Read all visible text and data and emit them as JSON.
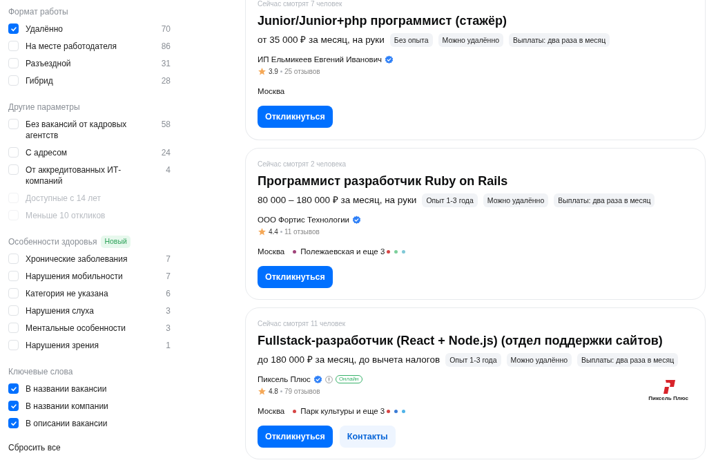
{
  "filters": [
    {
      "title": "Формат работы",
      "items": [
        {
          "label": "Удалённо",
          "count": "70",
          "checked": true,
          "disabled": false
        },
        {
          "label": "На месте работодателя",
          "count": "86",
          "checked": false,
          "disabled": false
        },
        {
          "label": "Разъездной",
          "count": "31",
          "checked": false,
          "disabled": false
        },
        {
          "label": "Гибрид",
          "count": "28",
          "checked": false,
          "disabled": false
        }
      ]
    },
    {
      "title": "Другие параметры",
      "items": [
        {
          "label": "Без вакансий от кадровых агентств",
          "count": "58",
          "checked": false,
          "disabled": false
        },
        {
          "label": "С адресом",
          "count": "24",
          "checked": false,
          "disabled": false
        },
        {
          "label": "От аккредитованных ИТ-компаний",
          "count": "4",
          "checked": false,
          "disabled": false
        },
        {
          "label": "Доступные с 14 лет",
          "checked": false,
          "disabled": true
        },
        {
          "label": "Меньше 10 откликов",
          "checked": false,
          "disabled": true
        }
      ]
    },
    {
      "title": "Особенности здоровья",
      "badge": "Новый",
      "items": [
        {
          "label": "Хронические заболевания",
          "count": "7",
          "checked": false,
          "disabled": false
        },
        {
          "label": "Нарушения мобильности",
          "count": "7",
          "checked": false,
          "disabled": false
        },
        {
          "label": "Категория не указана",
          "count": "6",
          "checked": false,
          "disabled": false
        },
        {
          "label": "Нарушения слуха",
          "count": "3",
          "checked": false,
          "disabled": false
        },
        {
          "label": "Ментальные особенности",
          "count": "3",
          "checked": false,
          "disabled": false
        },
        {
          "label": "Нарушения зрения",
          "count": "1",
          "checked": false,
          "disabled": false
        }
      ]
    },
    {
      "title": "Ключевые слова",
      "items": [
        {
          "label": "В названии вакансии",
          "checked": true,
          "disabled": false
        },
        {
          "label": "В названии компании",
          "checked": true,
          "disabled": false
        },
        {
          "label": "В описании вакансии",
          "checked": true,
          "disabled": false
        }
      ]
    }
  ],
  "reset_link": "Сбросить все",
  "vacancies": [
    {
      "viewers": "Сейчас смотрят 7 человек",
      "title": "Junior/Junior+php программист (стажёр)",
      "salary": "от 35 000 ₽ за месяц, на руки",
      "tags": [
        "Без опыта",
        "Можно удалённо",
        "Выплаты: два раза в месяц"
      ],
      "company": "ИП Ельмикеев Евгений Иванович",
      "rating": "3.9",
      "reviews": "25 отзывов",
      "city": "Москва",
      "buttons": [
        "Откликнуться"
      ]
    },
    {
      "viewers": "Сейчас смотрят 2 человека",
      "title": "Программист разработчик Ruby on Rails",
      "salary": "80 000 – 180 000 ₽ за месяц, на руки",
      "tags": [
        "Опыт 1-3 года",
        "Можно удалённо",
        "Выплаты: два раза в месяц"
      ],
      "company": "ООО Фортис Технологии",
      "rating": "4.4",
      "reviews": "11 отзывов",
      "city": "Москва",
      "metro": {
        "station": "Полежаевская и еще 3",
        "color": "#a0437a",
        "more_lines": [
          {
            "color": "#d64545"
          },
          {
            "color": "#7ccf9b"
          },
          {
            "color": "#7fc8d6"
          }
        ]
      },
      "buttons": [
        "Откликнуться"
      ]
    },
    {
      "viewers": "Сейчас смотрят 11 человек",
      "title": "Fullstack-разработчик (React + Node.js) (отдел поддержки сайтов)",
      "salary": "до 180 000 ₽ за месяц, до вычета налогов",
      "tags": [
        "Опыт 1-3 года",
        "Можно удалённо",
        "Выплаты: два раза в месяц"
      ],
      "company": "Пиксель Плюс",
      "online": "Онлайн",
      "rating": "4.8",
      "reviews": "79 отзывов",
      "city": "Москва",
      "metro": {
        "station": "Парк культуры и еще 3",
        "color": "#d64545",
        "more_lines": [
          {
            "color": "#d64545"
          },
          {
            "color": "#3a7bd5"
          },
          {
            "color": "#4fb3e8"
          }
        ]
      },
      "logo_text": "Пиксель Плюс",
      "buttons": [
        "Откликнуться",
        "Контакты"
      ]
    }
  ]
}
